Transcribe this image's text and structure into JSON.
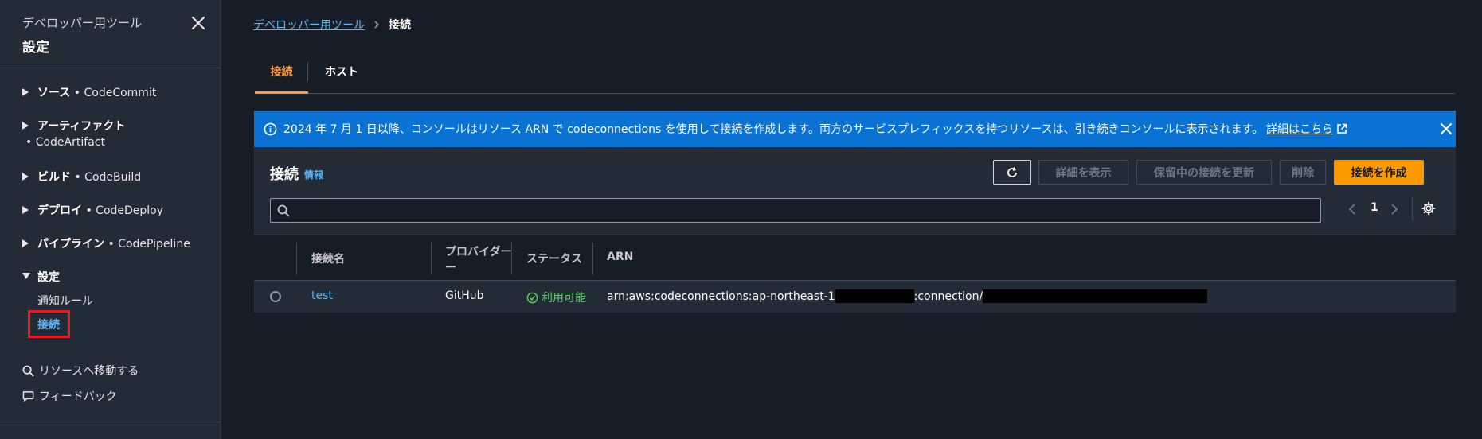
{
  "sidebar": {
    "subtitle": "デベロッパー用ツール",
    "title": "設定",
    "items": [
      {
        "label": "ソース",
        "sep": " • ",
        "service": "CodeCommit"
      },
      {
        "label": "アーティファクト",
        "service": "• CodeArtifact"
      },
      {
        "label": "ビルド",
        "sep": " • ",
        "service": "CodeBuild"
      },
      {
        "label": "デプロイ",
        "sep": " • ",
        "service": "CodeDeploy"
      },
      {
        "label": "パイプライン",
        "sep": " • ",
        "service": "CodePipeline"
      },
      {
        "label": "設定"
      }
    ],
    "settings_children": [
      "通知ルール",
      "接続"
    ],
    "go_to_resource": "リソースへ移動する",
    "feedback": "フィードバック"
  },
  "breadcrumb": {
    "parent": "デベロッパー用ツール",
    "current": "接続"
  },
  "tabs": [
    "接続",
    "ホスト"
  ],
  "flash": {
    "message": "2024 年 7 月 1 日以降、コンソールはリソース ARN で codeconnections を使用して接続を作成します。両方のサービスプレフィックスを持つリソースは、引き続きコンソールに表示されます。",
    "link": "詳細はこちら"
  },
  "panel": {
    "title": "接続",
    "info": "情報",
    "buttons": {
      "details": "詳細を表示",
      "update_pending": "保留中の接続を更新",
      "delete": "削除",
      "create": "接続を作成"
    },
    "search_value": "",
    "page": "1",
    "columns": [
      "接続名",
      "プロバイダー",
      "ー",
      "ステータス",
      "ARN"
    ],
    "rows": [
      {
        "name": "test",
        "provider": "GitHub",
        "status": "利用可能",
        "arn_prefix": "arn:aws:codeconnections:ap-northeast-1",
        "arn_mid": ":connection/"
      }
    ]
  },
  "colors": {
    "accent_orange": "#ff9900",
    "link_blue": "#5db6f5",
    "flash_blue": "#0972d3",
    "status_green": "#5fca6b",
    "highlight_red": "#e11d2a"
  }
}
